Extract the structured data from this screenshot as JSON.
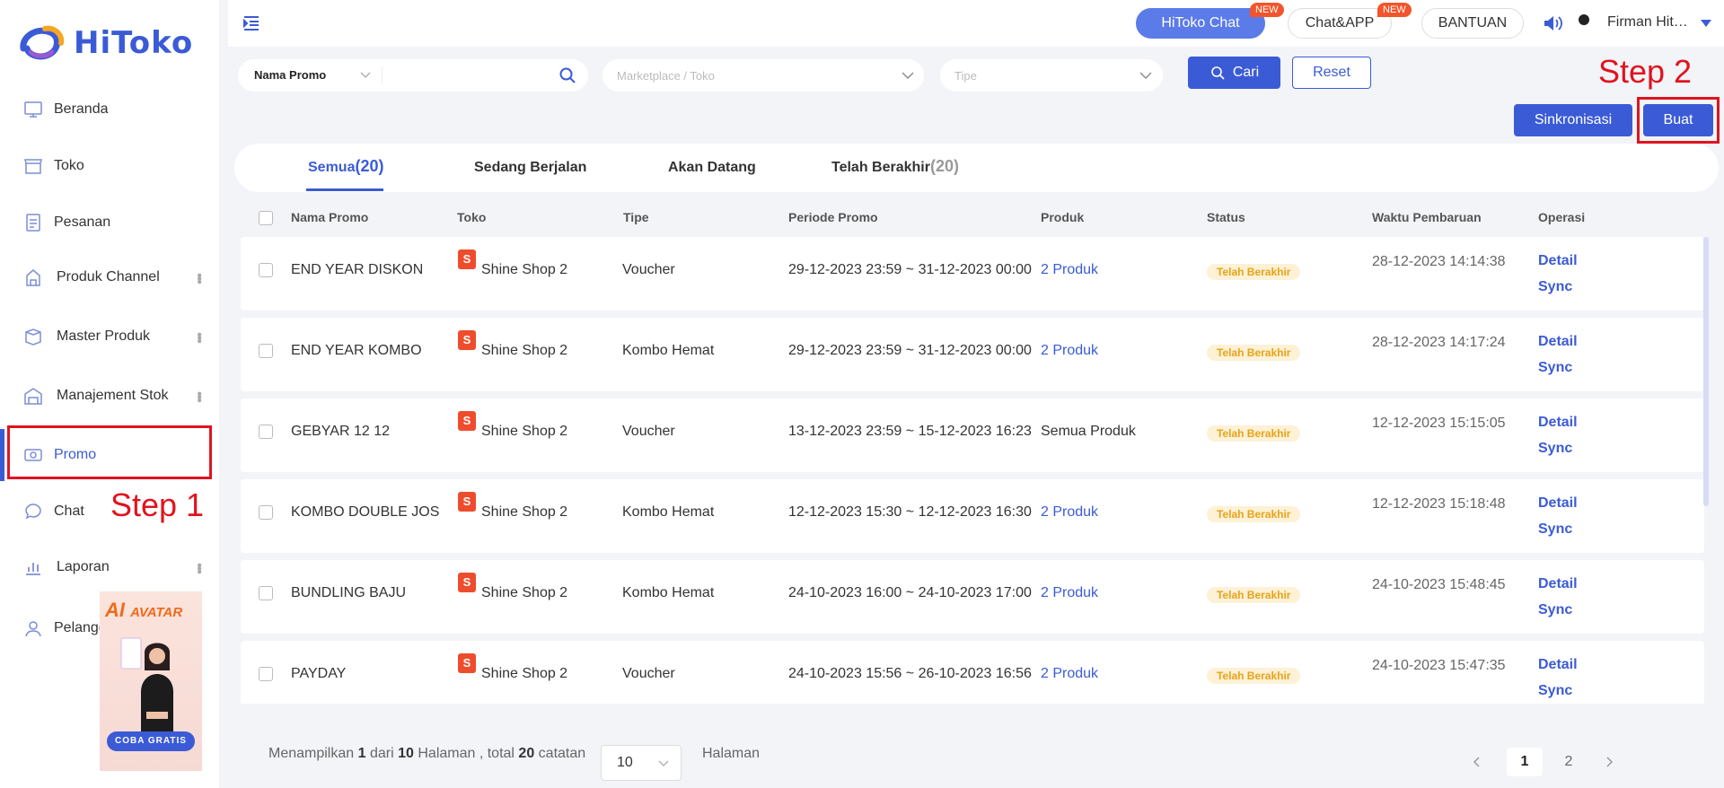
{
  "app": {
    "name": "HiToko"
  },
  "sidebar": {
    "items": [
      {
        "label": "Beranda",
        "icon": "monitor-icon"
      },
      {
        "label": "Toko",
        "icon": "store-icon"
      },
      {
        "label": "Pesanan",
        "icon": "order-icon"
      },
      {
        "label": "Produk Channel",
        "icon": "product-channel-icon"
      },
      {
        "label": "Master Produk",
        "icon": "master-product-icon"
      },
      {
        "label": "Manajement Stok",
        "icon": "warehouse-icon"
      },
      {
        "label": "Promo",
        "icon": "promo-icon"
      },
      {
        "label": "Chat",
        "icon": "chat-icon"
      },
      {
        "label": "Laporan",
        "icon": "report-icon"
      },
      {
        "label": "Pelanggan",
        "icon": "customer-icon"
      }
    ],
    "active": "Promo"
  },
  "annotations": {
    "step1": "Step 1",
    "step2": "Step 2"
  },
  "ai_banner": {
    "title_big": "AI",
    "title_small": "AVATAR",
    "cta": "COBA GRATIS"
  },
  "topbar": {
    "hitoko_chat": "HiToko Chat",
    "chat_app": "Chat&APP",
    "new_tag": "NEW",
    "bantuan": "BANTUAN",
    "user": "Firman Hit…"
  },
  "filters": {
    "promo_type_label": "Nama Promo",
    "marketplace_placeholder": "Marketplace / Toko",
    "tipe_placeholder": "Tipe",
    "search_button": "Cari",
    "reset_button": "Reset"
  },
  "actions": {
    "sync": "Sinkronisasi",
    "create": "Buat"
  },
  "tabs": [
    {
      "label": "Semua",
      "count": "(20)"
    },
    {
      "label": "Sedang Berjalan",
      "count": ""
    },
    {
      "label": "Akan Datang",
      "count": ""
    },
    {
      "label": "Telah Berakhir",
      "count": "(20)"
    }
  ],
  "table": {
    "columns": [
      "Nama Promo",
      "Toko",
      "Tipe",
      "Periode Promo",
      "Produk",
      "Status",
      "Waktu Pembaruan",
      "Operasi"
    ],
    "rows": [
      {
        "name": "END YEAR DISKON",
        "shop": "Shine Shop 2",
        "type": "Voucher",
        "period": "29-12-2023 23:59 ~ 31-12-2023 00:00",
        "product": "2 Produk",
        "product_link": true,
        "status": "Telah Berakhir",
        "updated": "28-12-2023 14:14:38"
      },
      {
        "name": "END YEAR KOMBO",
        "shop": "Shine Shop 2",
        "type": "Kombo Hemat",
        "period": "29-12-2023 23:59 ~ 31-12-2023 00:00",
        "product": "2 Produk",
        "product_link": true,
        "status": "Telah Berakhir",
        "updated": "28-12-2023 14:17:24"
      },
      {
        "name": "GEBYAR 12 12",
        "shop": "Shine Shop 2",
        "type": "Voucher",
        "period": "13-12-2023 23:59 ~ 15-12-2023 16:23",
        "product": "Semua Produk",
        "product_link": false,
        "status": "Telah Berakhir",
        "updated": "12-12-2023 15:15:05"
      },
      {
        "name": "KOMBO DOUBLE JOS",
        "shop": "Shine Shop 2",
        "type": "Kombo Hemat",
        "period": "12-12-2023 15:30 ~ 12-12-2023 16:30",
        "product": "2 Produk",
        "product_link": true,
        "status": "Telah Berakhir",
        "updated": "12-12-2023 15:18:48"
      },
      {
        "name": "BUNDLING BAJU",
        "shop": "Shine Shop 2",
        "type": "Kombo Hemat",
        "period": "24-10-2023 16:00 ~ 24-10-2023 17:00",
        "product": "2 Produk",
        "product_link": true,
        "status": "Telah Berakhir",
        "updated": "24-10-2023 15:48:45"
      },
      {
        "name": "PAYDAY",
        "shop": "Shine Shop 2",
        "type": "Voucher",
        "period": "24-10-2023 15:56 ~ 26-10-2023 16:56",
        "product": "2 Produk",
        "product_link": true,
        "status": "Telah Berakhir",
        "updated": "24-10-2023 15:47:35"
      }
    ],
    "op_detail": "Detail",
    "op_sync": "Sync"
  },
  "pagination": {
    "text_prefix": "Menampilkan",
    "current": "1",
    "text_of": "dari",
    "pages": "10",
    "text_pages": "Halaman , total",
    "total": "20",
    "text_records": "catatan",
    "page_size": "10",
    "page_label": "Halaman",
    "page_buttons": [
      "1",
      "2"
    ]
  }
}
